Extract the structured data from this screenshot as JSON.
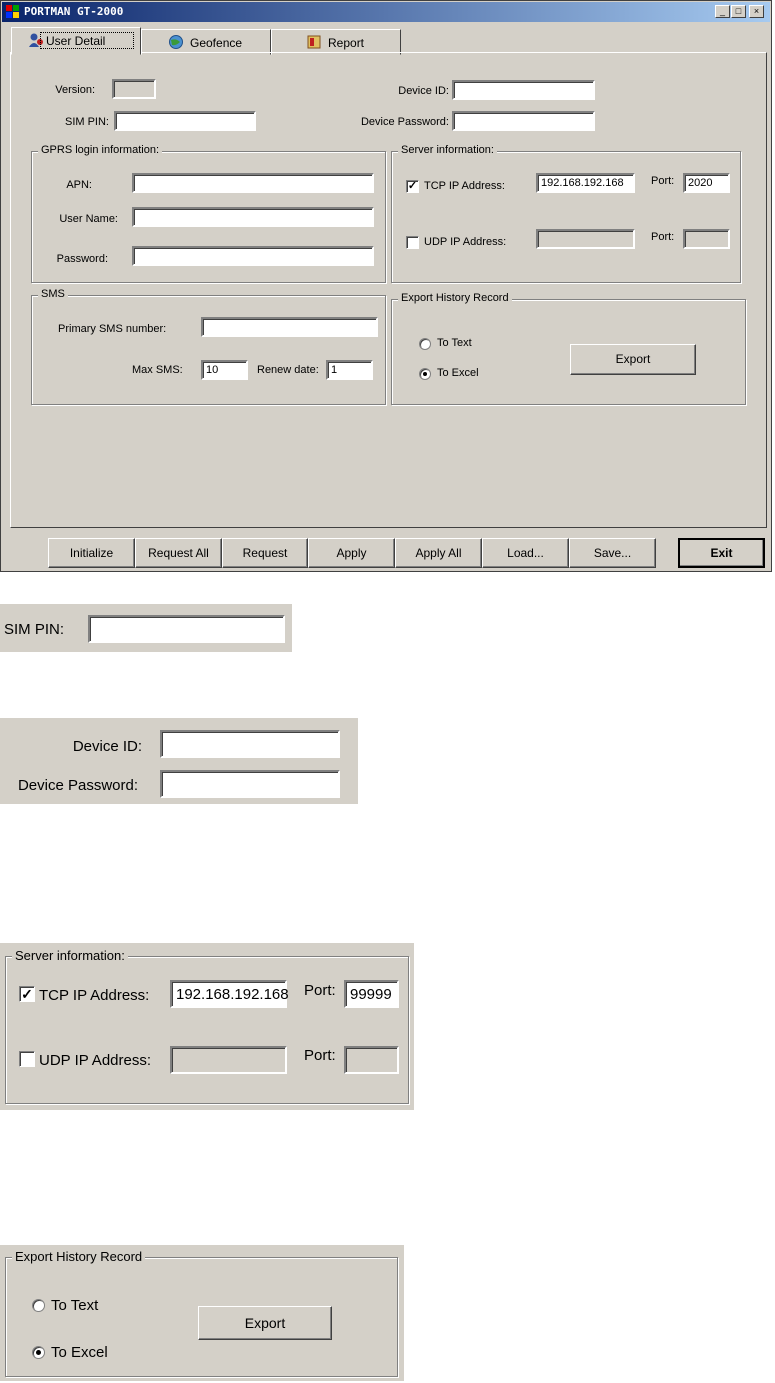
{
  "window": {
    "title": "PORTMAN GT-2000",
    "controls": [
      "_",
      "□",
      "×"
    ]
  },
  "tabs": [
    {
      "label": "User Detail",
      "icon": "user-detail-icon"
    },
    {
      "label": "Geofence",
      "icon": "globe-icon"
    },
    {
      "label": "Report",
      "icon": "report-book-icon"
    }
  ],
  "user_detail": {
    "version_label": "Version:",
    "sim_pin_label": "SIM PIN:",
    "device_id_label": "Device ID:",
    "device_password_label": "Device Password:",
    "sim_pin_value": "",
    "device_id_value": "",
    "device_password_value": ""
  },
  "gprs": {
    "title": "GPRS login information:",
    "apn_label": "APN:",
    "user_name_label": "User Name:",
    "password_label": "Password:"
  },
  "server": {
    "title": "Server information:",
    "tcp_label": "TCP IP Address:",
    "udp_label": "UDP IP Address:",
    "port_label": "Port:",
    "tcp_checked": true,
    "udp_checked": false,
    "tcp_ip": "192.168.192.168",
    "tcp_port": "2020",
    "check_mark": "✓"
  },
  "sms": {
    "title": "SMS",
    "primary_label": "Primary SMS number:",
    "max_sms_label": "Max SMS:",
    "max_sms_value": "10",
    "renew_label": "Renew date:",
    "renew_value": "1"
  },
  "export": {
    "title": "Export History Record",
    "to_text_label": "To Text",
    "to_excel_label": "To Excel",
    "selected": "To Excel",
    "button_label": "Export"
  },
  "bottom_buttons": {
    "initialize": "Initialize",
    "request_all": "Request All",
    "request": "Request",
    "apply": "Apply",
    "apply_all": "Apply All",
    "load": "Load...",
    "save": "Save...",
    "exit": "Exit"
  },
  "zoom_sim": {
    "label": "SIM PIN:"
  },
  "zoom_device": {
    "device_id_label": "Device ID:",
    "device_password_label": "Device Password:"
  },
  "zoom_server": {
    "title": "Server information:",
    "tcp_label": "TCP IP Address:",
    "udp_label": "UDP IP Address:",
    "port_label": "Port:",
    "tcp_ip": "192.168.192.168",
    "tcp_port": "99999"
  },
  "zoom_export": {
    "title": "Export History Record",
    "to_text_label": "To Text",
    "to_excel_label": "To Excel",
    "button_label": "Export"
  }
}
